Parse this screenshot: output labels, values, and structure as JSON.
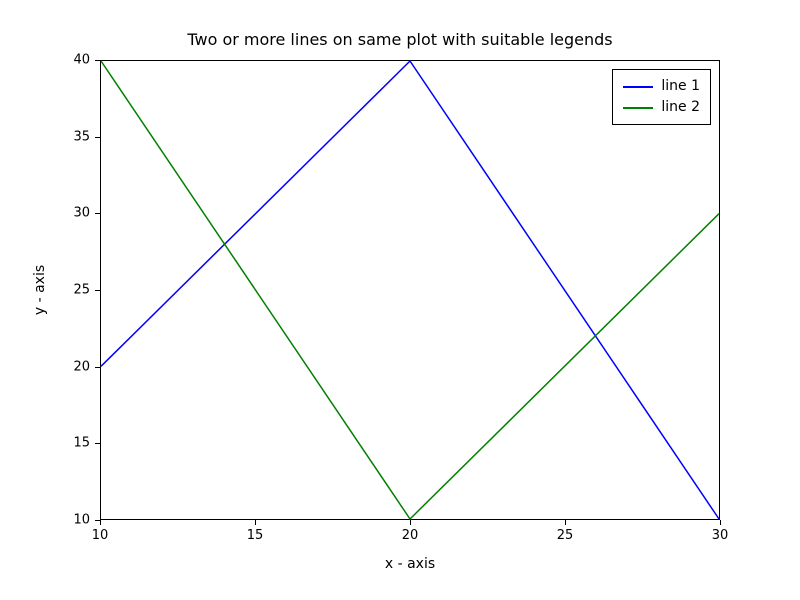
{
  "chart_data": {
    "type": "line",
    "title": "Two or more lines on same plot with suitable legends",
    "xlabel": "x - axis",
    "ylabel": "y - axis",
    "xlim": [
      10,
      30
    ],
    "ylim": [
      10,
      40
    ],
    "xticks": [
      10,
      15,
      20,
      25,
      30
    ],
    "yticks": [
      10,
      15,
      20,
      25,
      30,
      35,
      40
    ],
    "x": [
      10,
      20,
      30
    ],
    "series": [
      {
        "name": "line 1",
        "values": [
          20,
          40,
          10
        ],
        "color": "#0000ff"
      },
      {
        "name": "line 2",
        "values": [
          40,
          10,
          30
        ],
        "color": "#008000"
      }
    ],
    "legend_position": "upper right"
  }
}
